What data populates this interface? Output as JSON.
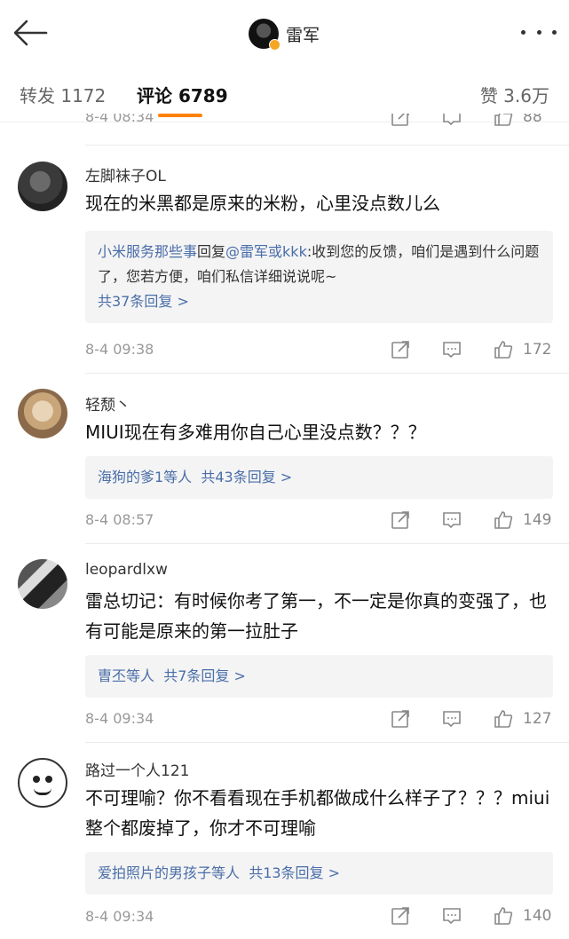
{
  "header": {
    "author_name": "雷军",
    "icons": {
      "back": "back-arrow-icon",
      "more": "more-dots-icon",
      "verified": "verified-badge-icon"
    }
  },
  "tabs": [
    {
      "label": "转发 1172"
    },
    {
      "label": "评论 6789"
    },
    {
      "label": "赞 3.6万"
    }
  ],
  "accent_color": "#ff8200",
  "link_color": "#4a6ea9",
  "previous_comment": {
    "time": "8-4 08:34",
    "likes": "88"
  },
  "comments": [
    {
      "user": "左脚袜子OL",
      "text": "现在的米黑都是原来的米粉，心里没点数儿么",
      "reply": {
        "from": "小米服务那些事",
        "verb": "回复",
        "to": "@雷军或kkk",
        "content": ":收到您的反馈，咱们是遇到什么问题了，您若方便，咱们私信详细说说呢~",
        "more": "共37条回复 >"
      },
      "time": "8-4 09:38",
      "likes": "172"
    },
    {
      "user": "轻颓丶",
      "text": "MIUI现在有多难用你自己心里没点数？？？",
      "reply_summary": {
        "names": "海狗的爹1等人",
        "more": "共43条回复 >"
      },
      "time": "8-4 08:57",
      "likes": "149"
    },
    {
      "user": "leopardlxw",
      "text": "雷总切记：有时候你考了第一，不一定是你真的变强了，也有可能是原来的第一拉肚子",
      "reply_summary": {
        "names": "曺丕等人",
        "more": "共7条回复 >"
      },
      "time": "8-4 09:34",
      "likes": "127"
    },
    {
      "user": "路过一个人121",
      "text": "不可理喻？你不看看现在手机都做成什么样子了？？？miui整个都废掉了，你才不可理喻",
      "reply_summary": {
        "names": "爱拍照片的男孩子等人",
        "more": "共13条回复 >"
      },
      "time": "8-4 09:34",
      "likes": "140"
    }
  ]
}
